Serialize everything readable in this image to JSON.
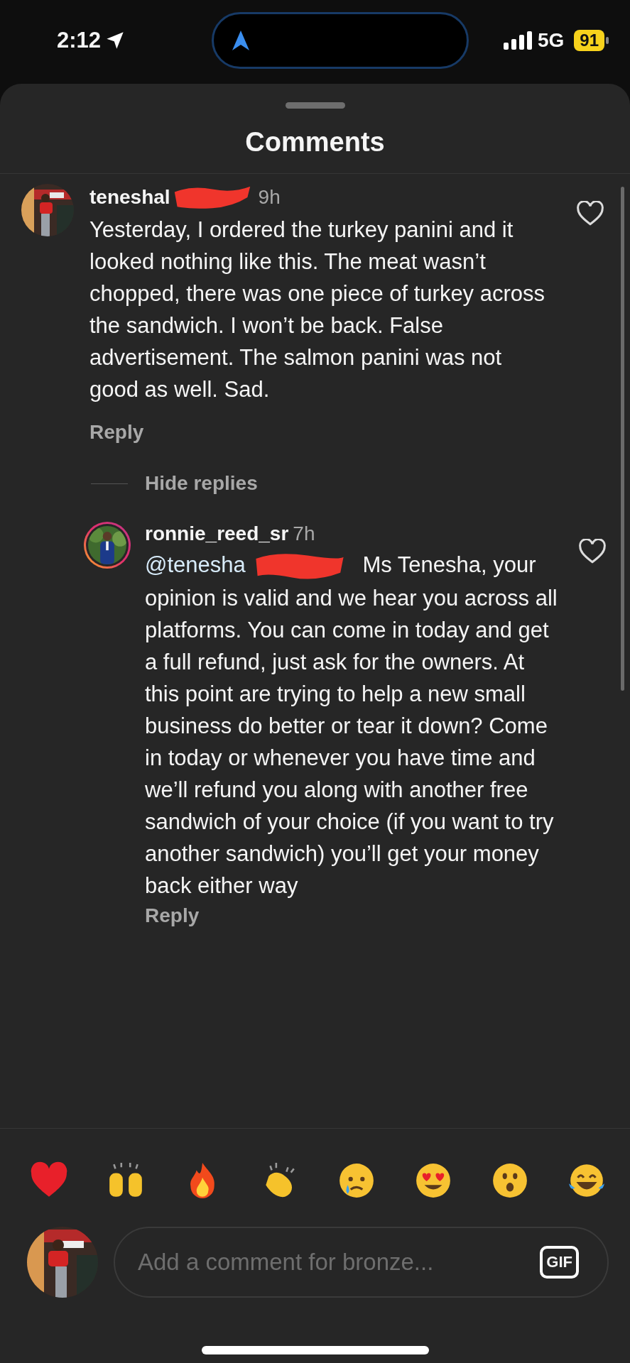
{
  "status_bar": {
    "time": "2:12",
    "network": "5G",
    "battery": "91"
  },
  "sheet": {
    "title": "Comments"
  },
  "comments": [
    {
      "username": "teneshal",
      "redacted": true,
      "time": "9h",
      "text": "Yesterday, I ordered the turkey panini and it looked nothing like this. The meat wasn’t chopped, there was one piece of turkey across the sandwich. I won’t be back. False advertisement. The salmon panini was not good as well. Sad.",
      "liked": false,
      "reply_label": "Reply",
      "toggle_label": "Hide replies",
      "replies": [
        {
          "username": "ronnie_reed_sr",
          "time": "7h",
          "story_ring": true,
          "mention": "@tenesha",
          "mention_redacted": true,
          "text": "Ms Tenesha, your opinion is valid and we hear you across all platforms. You can come in today and get a full refund, just ask for the owners. At this point are trying to help a new small business do better or tear it down? Come in today or whenever you have time and we’ll refund you along with another free sandwich of your choice (if you want to try another sandwich) you’ll get your money back either way",
          "liked": false,
          "reply_label": "Reply"
        }
      ]
    }
  ],
  "composer": {
    "placeholder": "Add a comment for bronze...",
    "gif_label": "GIF"
  }
}
